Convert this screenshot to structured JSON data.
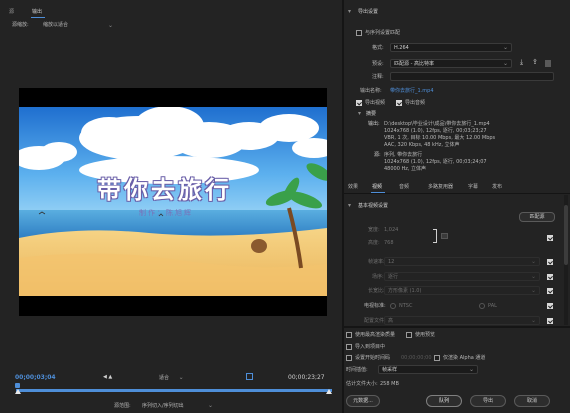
{
  "left_panel": {
    "tab_source": "源",
    "tab_output": "输出",
    "source_scaling_label": "源缩放:",
    "source_scaling_value": "缩放以适合",
    "video_title": "带你去旅行",
    "video_subtitle": "制作：陈旭辉",
    "timecode_in": "00;00;03;04",
    "fit_label": "适合",
    "timecode_duration": "00;00;23;27",
    "source_range_label": "源范围:",
    "source_range_value": "序列切入/序列切出"
  },
  "export_settings": {
    "section_title": "导出设置",
    "match_sequence_label": "与序列设置匹配",
    "format_label": "格式:",
    "format_value": "H.264",
    "preset_label": "预设:",
    "preset_value": "匹配源 - 高比特率",
    "comments_label": "注释:",
    "output_name_label": "输出名称:",
    "output_name_value": "带你去旅行_1.mp4",
    "export_video_label": "导出视频",
    "export_audio_label": "导出音频",
    "summary_title": "摘要",
    "summary_output_label": "输出:",
    "summary_output_lines": [
      "D:\\desktop\\毕业设计\\成品\\带你去旅行_1.mp4",
      "1024x768 (1.0), 12fps, 逐行, 00;03;23;27",
      "VBR, 1 次, 目标 10.00 Mbps, 最大 12.00 Mbps",
      "AAC, 320 Kbps, 48 kHz, 立体声"
    ],
    "summary_source_label": "源:",
    "summary_source_lines": [
      "序列, 带你去旅行",
      "1024x768 (1.0), 12fps, 逐行, 00;03;24;07",
      "48000 Hz, 立体声"
    ]
  },
  "tabs": [
    "效果",
    "视频",
    "音频",
    "多路复用器",
    "字幕",
    "发布"
  ],
  "active_tab": "视频",
  "basic_video": {
    "section_title": "基本视频设置",
    "match_source_button": "匹配源",
    "width_label": "宽度:",
    "width_value": "1,024",
    "height_label": "高度:",
    "height_value": "768",
    "frame_rate_label": "帧速率:",
    "frame_rate_value": "12",
    "field_order_label": "场序:",
    "field_order_value": "逐行",
    "aspect_label": "长宽比:",
    "aspect_value": "方形像素 (1.0)",
    "tv_standard_label": "电视标准:",
    "tv_ntsc": "NTSC",
    "tv_pal": "PAL",
    "profile_label": "配置文件:",
    "profile_value": "高"
  },
  "bottom_options": {
    "max_render_quality": "使用最高渲染质量",
    "use_previews": "使用预览",
    "import_into_project": "导入到项目中",
    "set_start_timecode": "设置开始时间码",
    "start_timecode_value": "00;00;00;00",
    "render_alpha_only": "仅渲染 Alpha 通道",
    "time_interpolation_label": "时间插值:",
    "time_interpolation_value": "帧采样",
    "estimated_size_label": "估计文件大小:",
    "estimated_size_value": "258 MB"
  },
  "buttons": {
    "metadata": "元数据...",
    "queue": "队列",
    "export": "导出",
    "cancel": "取消"
  },
  "colors": {
    "accent_blue": "#4e8ed8",
    "panel_bg": "#232323",
    "sky": "#3e8fd8",
    "sand": "#f1c66b"
  }
}
